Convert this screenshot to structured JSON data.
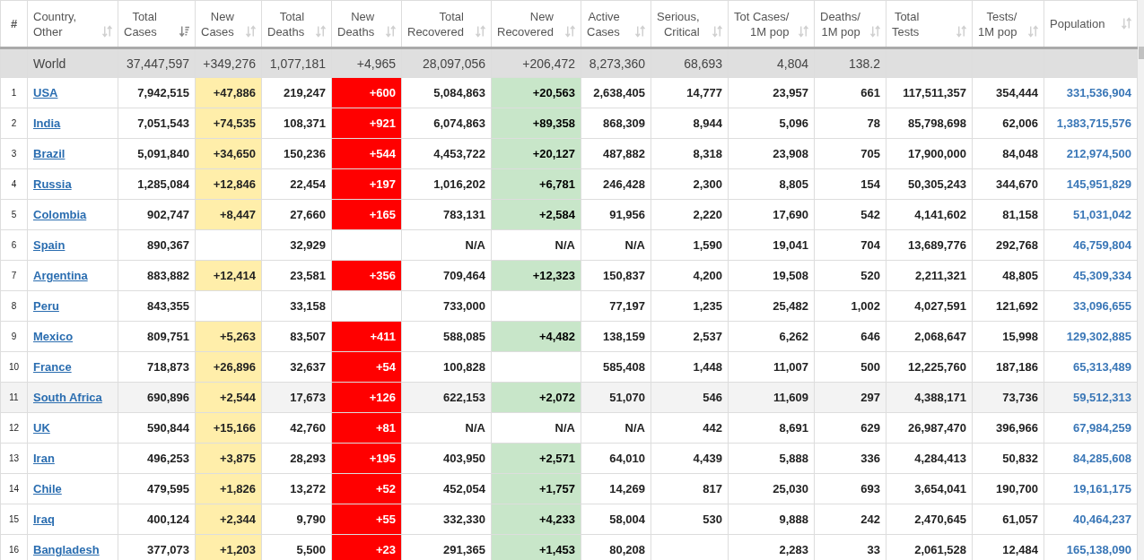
{
  "table": {
    "columns": [
      {
        "label": "#",
        "kind": "rank"
      },
      {
        "label": "Country,\nOther",
        "kind": "country",
        "sorted": false
      },
      {
        "label": "Total\nCases",
        "kind": "number",
        "sorted": true
      },
      {
        "label": "New\nCases",
        "kind": "new_cases",
        "sorted": false
      },
      {
        "label": "Total\nDeaths",
        "kind": "number",
        "sorted": false
      },
      {
        "label": "New\nDeaths",
        "kind": "new_deaths",
        "sorted": false
      },
      {
        "label": "Total\nRecovered",
        "kind": "number",
        "sorted": false
      },
      {
        "label": "New\nRecovered",
        "kind": "new_recovered",
        "sorted": false
      },
      {
        "label": "Active\nCases",
        "kind": "number",
        "sorted": false
      },
      {
        "label": "Serious,\nCritical",
        "kind": "number",
        "sorted": false
      },
      {
        "label": "Tot Cases/\n1M pop",
        "kind": "number",
        "sorted": false
      },
      {
        "label": "Deaths/\n1M pop",
        "kind": "number",
        "sorted": false
      },
      {
        "label": "Total\nTests",
        "kind": "number",
        "sorted": false
      },
      {
        "label": "Tests/\n1M pop",
        "kind": "number",
        "sorted": false
      },
      {
        "label": "Population",
        "kind": "population",
        "sorted": false
      }
    ],
    "rows": [
      {
        "kind": "world",
        "selected": false,
        "cells": [
          null,
          "World",
          "37,447,597",
          "+349,276",
          "1,077,181",
          "+4,965",
          "28,097,056",
          "+206,472",
          "8,273,360",
          "68,693",
          "4,804",
          "138.2",
          null,
          null,
          null
        ]
      },
      {
        "kind": "country",
        "selected": false,
        "cells": [
          "1",
          "USA",
          "7,942,515",
          "+47,886",
          "219,247",
          "+600",
          "5,084,863",
          "+20,563",
          "2,638,405",
          "14,777",
          "23,957",
          "661",
          "117,511,357",
          "354,444",
          "331,536,904"
        ]
      },
      {
        "kind": "country",
        "selected": false,
        "cells": [
          "2",
          "India",
          "7,051,543",
          "+74,535",
          "108,371",
          "+921",
          "6,074,863",
          "+89,358",
          "868,309",
          "8,944",
          "5,096",
          "78",
          "85,798,698",
          "62,006",
          "1,383,715,576"
        ]
      },
      {
        "kind": "country",
        "selected": false,
        "cells": [
          "3",
          "Brazil",
          "5,091,840",
          "+34,650",
          "150,236",
          "+544",
          "4,453,722",
          "+20,127",
          "487,882",
          "8,318",
          "23,908",
          "705",
          "17,900,000",
          "84,048",
          "212,974,500"
        ]
      },
      {
        "kind": "country",
        "selected": false,
        "cells": [
          "4",
          "Russia",
          "1,285,084",
          "+12,846",
          "22,454",
          "+197",
          "1,016,202",
          "+6,781",
          "246,428",
          "2,300",
          "8,805",
          "154",
          "50,305,243",
          "344,670",
          "145,951,829"
        ]
      },
      {
        "kind": "country",
        "selected": false,
        "cells": [
          "5",
          "Colombia",
          "902,747",
          "+8,447",
          "27,660",
          "+165",
          "783,131",
          "+2,584",
          "91,956",
          "2,220",
          "17,690",
          "542",
          "4,141,602",
          "81,158",
          "51,031,042"
        ]
      },
      {
        "kind": "country",
        "selected": false,
        "recovered_na": true,
        "cells": [
          "6",
          "Spain",
          "890,367",
          null,
          "32,929",
          null,
          "N/A",
          "N/A",
          "N/A",
          "1,590",
          "19,041",
          "704",
          "13,689,776",
          "292,768",
          "46,759,804"
        ]
      },
      {
        "kind": "country",
        "selected": false,
        "cells": [
          "7",
          "Argentina",
          "883,882",
          "+12,414",
          "23,581",
          "+356",
          "709,464",
          "+12,323",
          "150,837",
          "4,200",
          "19,508",
          "520",
          "2,211,321",
          "48,805",
          "45,309,334"
        ]
      },
      {
        "kind": "country",
        "selected": false,
        "cells": [
          "8",
          "Peru",
          "843,355",
          null,
          "33,158",
          null,
          "733,000",
          null,
          "77,197",
          "1,235",
          "25,482",
          "1,002",
          "4,027,591",
          "121,692",
          "33,096,655"
        ]
      },
      {
        "kind": "country",
        "selected": false,
        "cells": [
          "9",
          "Mexico",
          "809,751",
          "+5,263",
          "83,507",
          "+411",
          "588,085",
          "+4,482",
          "138,159",
          "2,537",
          "6,262",
          "646",
          "2,068,647",
          "15,998",
          "129,302,885"
        ]
      },
      {
        "kind": "country",
        "selected": false,
        "cells": [
          "10",
          "France",
          "718,873",
          "+26,896",
          "32,637",
          "+54",
          "100,828",
          null,
          "585,408",
          "1,448",
          "11,007",
          "500",
          "12,225,760",
          "187,186",
          "65,313,489"
        ]
      },
      {
        "kind": "country",
        "selected": true,
        "cells": [
          "11",
          "South Africa",
          "690,896",
          "+2,544",
          "17,673",
          "+126",
          "622,153",
          "+2,072",
          "51,070",
          "546",
          "11,609",
          "297",
          "4,388,171",
          "73,736",
          "59,512,313"
        ]
      },
      {
        "kind": "country",
        "selected": false,
        "recovered_na": true,
        "cells": [
          "12",
          "UK",
          "590,844",
          "+15,166",
          "42,760",
          "+81",
          "N/A",
          "N/A",
          "N/A",
          "442",
          "8,691",
          "629",
          "26,987,470",
          "396,966",
          "67,984,259"
        ]
      },
      {
        "kind": "country",
        "selected": false,
        "cells": [
          "13",
          "Iran",
          "496,253",
          "+3,875",
          "28,293",
          "+195",
          "403,950",
          "+2,571",
          "64,010",
          "4,439",
          "5,888",
          "336",
          "4,284,413",
          "50,832",
          "84,285,608"
        ]
      },
      {
        "kind": "country",
        "selected": false,
        "cells": [
          "14",
          "Chile",
          "479,595",
          "+1,826",
          "13,272",
          "+52",
          "452,054",
          "+1,757",
          "14,269",
          "817",
          "25,030",
          "693",
          "3,654,041",
          "190,700",
          "19,161,175"
        ]
      },
      {
        "kind": "country",
        "selected": false,
        "cells": [
          "15",
          "Iraq",
          "400,124",
          "+2,344",
          "9,790",
          "+55",
          "332,330",
          "+4,233",
          "58,004",
          "530",
          "9,888",
          "242",
          "2,470,645",
          "61,057",
          "40,464,237"
        ]
      },
      {
        "kind": "country",
        "selected": false,
        "cells": [
          "16",
          "Bangladesh",
          "377,073",
          "+1,203",
          "5,500",
          "+23",
          "291,365",
          "+1,453",
          "80,208",
          null,
          "2,283",
          "33",
          "2,061,528",
          "12,484",
          "165,138,090"
        ]
      }
    ]
  }
}
